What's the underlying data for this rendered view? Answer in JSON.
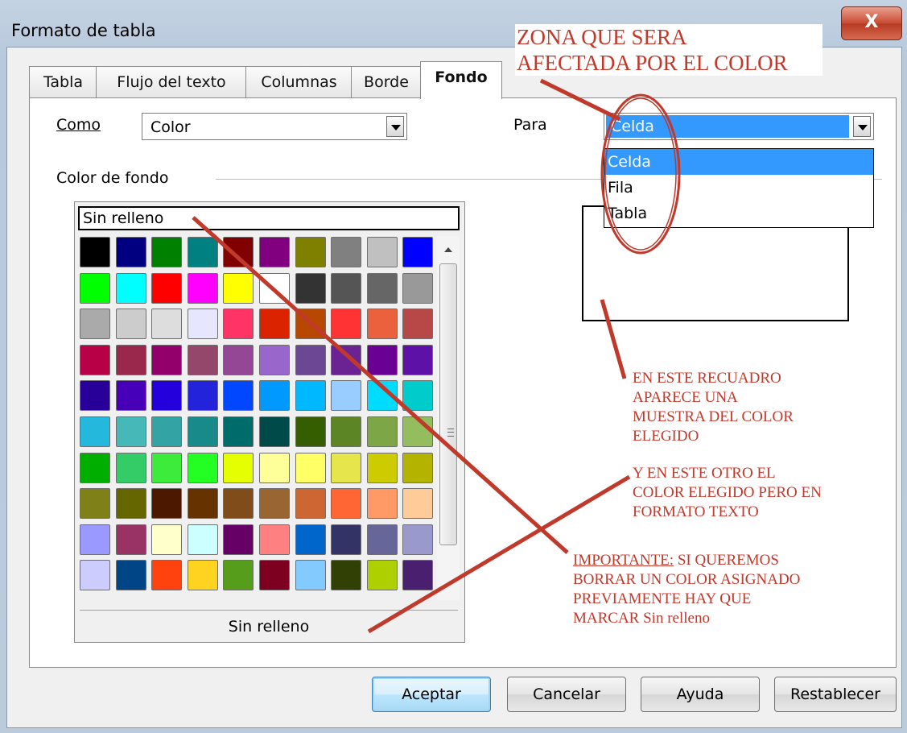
{
  "window": {
    "title": "Formato de tabla",
    "close_glyph": "X"
  },
  "tabs": [
    {
      "label": "Tabla",
      "active": false
    },
    {
      "label": "Flujo del texto",
      "active": false
    },
    {
      "label": "Columnas",
      "active": false
    },
    {
      "label": "Borde",
      "active": false
    },
    {
      "label": "Fondo",
      "active": true
    }
  ],
  "como": {
    "label": "Como",
    "value": "Color"
  },
  "para": {
    "label": "Para",
    "value": "Celda",
    "options": [
      "Celda",
      "Fila",
      "Tabla"
    ]
  },
  "color_de_fondo": {
    "label": "Color de fondo"
  },
  "palette": {
    "top_label": "Sin relleno",
    "bottom_label": "Sin relleno",
    "rows": [
      [
        "#000000",
        "#000080",
        "#008000",
        "#008080",
        "#800000",
        "#800080",
        "#808000",
        "#808080",
        "#c0c0c0",
        "#0000ff"
      ],
      [
        "#00ff00",
        "#00ffff",
        "#ff0000",
        "#ff00ff",
        "#ffff00",
        "#ffffff",
        "#333333",
        "#555555",
        "#666666",
        "#999999"
      ],
      [
        "#aaaaaa",
        "#cccccc",
        "#dddddd",
        "#e6e6ff",
        "#ff3366",
        "#dc2300",
        "#b84700",
        "#ff3333",
        "#eb613d",
        "#b84747"
      ],
      [
        "#b80047",
        "#99284c",
        "#94006b",
        "#94476b",
        "#944794",
        "#9966cc",
        "#6b4794",
        "#6b2394",
        "#6b0094",
        "#5e11a6"
      ],
      [
        "#280099",
        "#4700b8",
        "#2300dc",
        "#2323dc",
        "#0047ff",
        "#0099ff",
        "#00b8ff",
        "#99ccff",
        "#00dcff",
        "#00cccc"
      ],
      [
        "#23b8dc",
        "#47b8b8",
        "#33a3a3",
        "#198a8a",
        "#006b6b",
        "#004a4a",
        "#355e00",
        "#5c8526",
        "#7da647",
        "#94bd5e"
      ],
      [
        "#00ae00",
        "#33cc66",
        "#3deb3d",
        "#23ff23",
        "#e6ff00",
        "#ffff99",
        "#ffff66",
        "#e6e64c",
        "#cccc00",
        "#b3b300"
      ],
      [
        "#808019",
        "#666600",
        "#4c1900",
        "#663300",
        "#804c19",
        "#996633",
        "#cc6633",
        "#ff6633",
        "#ff9966",
        "#ffcc99"
      ],
      [
        "#9999ff",
        "#993366",
        "#ffffcc",
        "#ccffff",
        "#660066",
        "#ff8080",
        "#0066cc",
        "#333366",
        "#666699",
        "#9999cc"
      ],
      [
        "#ccccff",
        "#004586",
        "#ff420e",
        "#ffd320",
        "#579d1c",
        "#7e0021",
        "#83caff",
        "#314004",
        "#aecf00",
        "#4b1f6f"
      ]
    ]
  },
  "buttons": {
    "ok": "Aceptar",
    "cancel": "Cancelar",
    "help": "Ayuda",
    "reset": "Restablecer"
  },
  "annotations": {
    "zona_line1": "ZONA QUE SERA",
    "zona_line2": "AFECTADA POR EL COLOR",
    "recuadro": [
      "EN ESTE RECUADRO",
      "APARECE UNA",
      "MUESTRA DEL COLOR",
      "ELEGIDO"
    ],
    "otro": [
      "Y EN ESTE OTRO EL",
      "COLOR ELEGIDO PERO EN",
      "FORMATO TEXTO"
    ],
    "importante_label": "IMPORTANTE:",
    "importante_rest": " SI QUEREMOS",
    "importante_lines": [
      "BORRAR UN COLOR ASIGNADO",
      "PREVIAMENTE HAY QUE",
      "MARCAR  Sin relleno"
    ],
    "color": "#c0392b"
  }
}
